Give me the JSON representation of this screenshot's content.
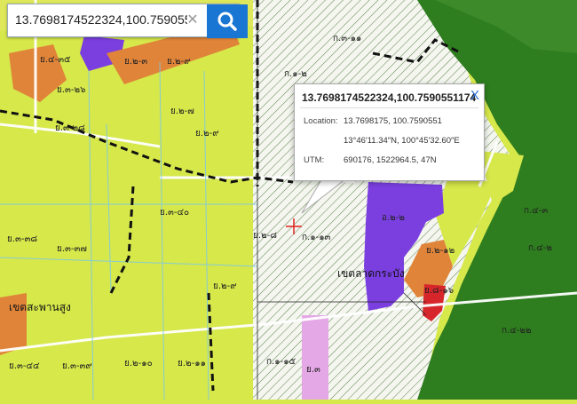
{
  "search": {
    "value": "13.7698174522324,100.7590551174",
    "clear_label": "✕",
    "button_icon": "search-icon"
  },
  "popup": {
    "title": "13.7698174522324,100.7590551174",
    "close_label": "X",
    "location_label": "Location:",
    "location_decimal": "13.7698175, 100.7590551",
    "location_dms": "13°46′11.34″N, 100°45′32.60″E",
    "utm_label": "UTM:",
    "utm_value": "690176, 1522964.5, 47N"
  },
  "map": {
    "zones": [
      "ย.๒-๑",
      "ย.๓-๓๔",
      "ย.๒-๓",
      "ย.๒-๗",
      "ย.๒-๙",
      "ย.๔-๓๕",
      "ย.๓-๒๖",
      "ย.๓-๒๘",
      "ย.๓-๓๗",
      "ย.๒-๘",
      "ย.๒-๙",
      "ย.๓-๓๓",
      "ย.๒-๑๐",
      "ย.๒-๑๑",
      "ย.๓-๓๔",
      "ย.๓-๔๐",
      "ย.๒-๔",
      "ก.๓-๓๓",
      "ก.๑-๑",
      "ก.๑-๑๕",
      "ย.๓",
      "ก.๑-๑๓",
      "ก.๑-๒",
      "ก.๔-๒",
      "ก.๔-๓",
      "ก.๔-๒๒",
      "ย.๒-๑๑",
      "ย.๘-๑๖",
      "อ.๒-๒"
    ],
    "districts": [
      "เขตสะพานสูง",
      "เขตลาดกระบัง"
    ],
    "marker_icon": "crosshair-icon",
    "colors": {
      "residential_low": "#d6e84a",
      "residential_med": "#efe03a",
      "agricultural": "#2e7d1f",
      "agri_light": "#56a43a",
      "commerce": "#e0843a",
      "industrial": "#7b3fe0",
      "gov": "#e5a8e6",
      "red": "#d7262b",
      "road": "#ffffff"
    }
  }
}
